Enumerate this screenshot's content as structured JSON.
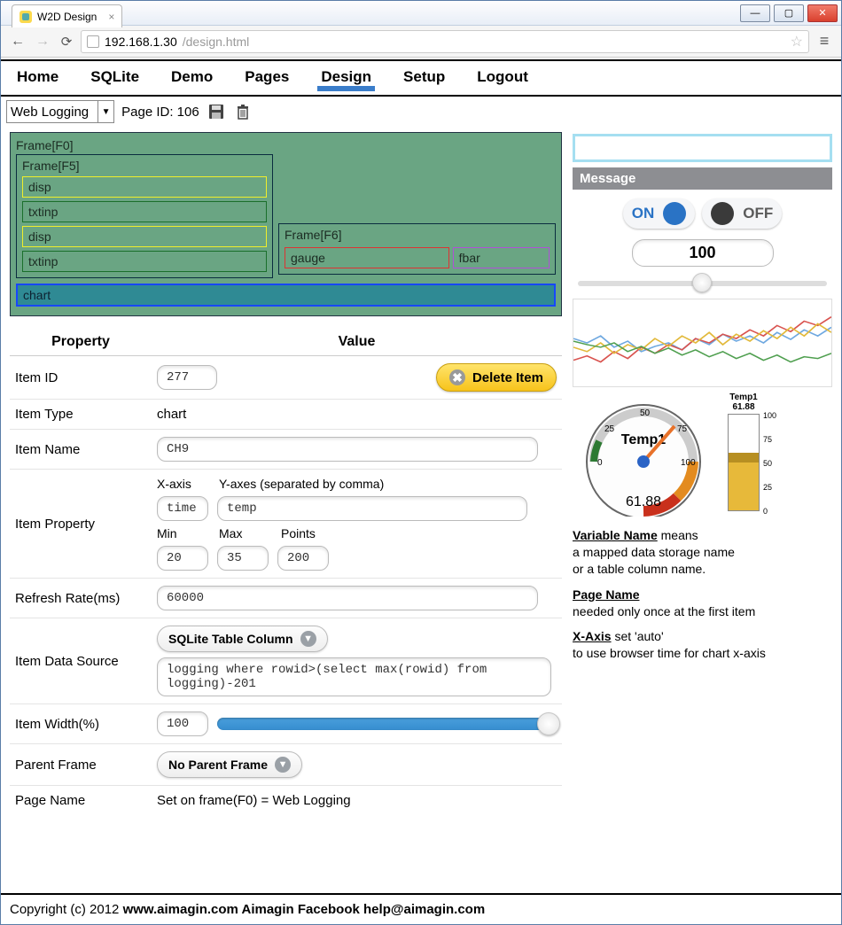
{
  "window": {
    "tab_title": "W2D Design",
    "url_host": "192.168.1.30",
    "url_path": "/design.html"
  },
  "nav": {
    "items": [
      "Home",
      "SQLite",
      "Demo",
      "Pages",
      "Design",
      "Setup",
      "Logout"
    ],
    "active_index": 4
  },
  "toolbar": {
    "page_dropdown": "Web Logging",
    "page_id_label": "Page ID: 106"
  },
  "canvas": {
    "frame0": "Frame[F0]",
    "frame5": "Frame[F5]",
    "frame6": "Frame[F6]",
    "widgets_f5": [
      "disp",
      "txtinp",
      "disp",
      "txtinp"
    ],
    "widgets_f6": {
      "gauge": "gauge",
      "fbar": "fbar"
    },
    "chart": "chart"
  },
  "props": {
    "header_property": "Property",
    "header_value": "Value",
    "item_id_label": "Item ID",
    "item_id": "277",
    "delete_label": "Delete Item",
    "item_type_label": "Item Type",
    "item_type": "chart",
    "item_name_label": "Item Name",
    "item_name": "CH9",
    "item_property_label": "Item Property",
    "xaxis_label": "X-axis",
    "yaxes_label": "Y-axes (separated by comma)",
    "xaxis": "time",
    "yaxes": "temp",
    "min_label": "Min",
    "max_label": "Max",
    "points_label": "Points",
    "min": "20",
    "max": "35",
    "points": "200",
    "refresh_label": "Refresh Rate(ms)",
    "refresh": "60000",
    "data_source_label": "Item Data Source",
    "data_source_btn": "SQLite Table Column",
    "data_source_query": "logging where rowid>(select max(rowid) from logging)-201",
    "width_label": "Item Width(%)",
    "width": "100",
    "parent_frame_label": "Parent Frame",
    "parent_frame_btn": "No Parent Frame",
    "page_name_label": "Page Name",
    "page_name_value": "Set on frame(F0) = Web Logging"
  },
  "right": {
    "message_header": "Message",
    "on": "ON",
    "off": "OFF",
    "number": "100",
    "gauge": {
      "title": "Temp1",
      "value": "61.88",
      "ticks": [
        "0",
        "25",
        "50",
        "75",
        "100"
      ]
    },
    "fbar": {
      "title": "Temp1",
      "value": "61.88",
      "ticks": [
        "100",
        "75",
        "50",
        "25",
        "0"
      ]
    },
    "help_var_name_head": "Variable Name",
    "help_var_name_body": " means\na mapped data storage name\nor a table column name.",
    "help_page_name_head": "Page Name",
    "help_page_name_body": "needed only once at the first item",
    "help_xaxis_head": "X-Axis",
    "help_xaxis_body": " set 'auto'\nto use browser time for chart x-axis"
  },
  "footer": {
    "copyright_pre": "Copyright (c) 2012 ",
    "site": "www.aimagin.com",
    "mid": " Aimagin Facebook ",
    "email": "help@aimagin.com"
  },
  "chart_data": {
    "type": "line",
    "title": "",
    "xlabel": "",
    "ylabel": "",
    "x": [
      0,
      1,
      2,
      3,
      4,
      5,
      6,
      7,
      8,
      9,
      10,
      11,
      12,
      13,
      14,
      15,
      16,
      17,
      18,
      19
    ],
    "ylim": [
      0,
      100
    ],
    "series": [
      {
        "name": "blue",
        "color": "#6fa8e0",
        "values": [
          55,
          50,
          58,
          45,
          52,
          40,
          46,
          50,
          42,
          55,
          48,
          60,
          52,
          58,
          50,
          62,
          54,
          65,
          58,
          68
        ]
      },
      {
        "name": "red",
        "color": "#d9534f",
        "values": [
          30,
          35,
          28,
          40,
          32,
          45,
          38,
          48,
          42,
          55,
          50,
          60,
          55,
          65,
          58,
          70,
          63,
          75,
          70,
          80
        ]
      },
      {
        "name": "yellow",
        "color": "#e2b93a",
        "values": [
          45,
          40,
          50,
          38,
          48,
          42,
          55,
          46,
          58,
          50,
          62,
          48,
          60,
          52,
          64,
          55,
          68,
          58,
          72,
          62
        ]
      },
      {
        "name": "green",
        "color": "#4f9f4f",
        "values": [
          52,
          48,
          45,
          50,
          40,
          46,
          38,
          44,
          36,
          42,
          34,
          40,
          32,
          38,
          30,
          36,
          28,
          34,
          32,
          38
        ]
      }
    ]
  }
}
